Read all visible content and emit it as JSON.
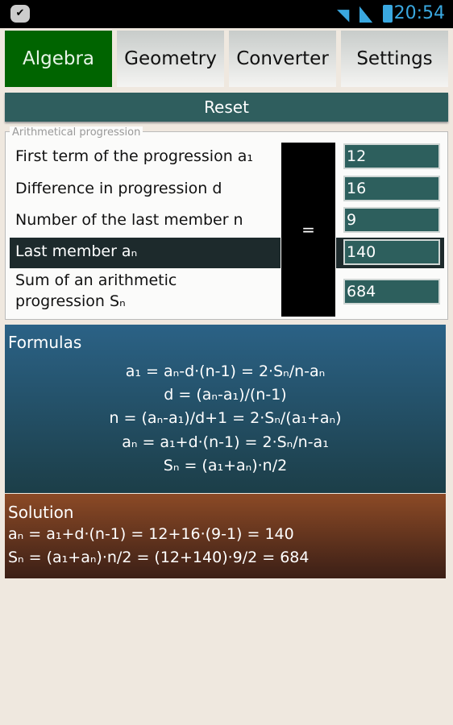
{
  "status_bar": {
    "time": "20:54",
    "icons": [
      "notification-check-icon",
      "wifi-icon",
      "signal-icon",
      "battery-icon"
    ]
  },
  "tabs": [
    {
      "label": "Algebra",
      "active": true
    },
    {
      "label": "Geometry"
    },
    {
      "label": "Converter"
    },
    {
      "label": "Settings"
    }
  ],
  "reset_label": "Reset",
  "progression": {
    "legend": "Arithmetical progression",
    "equals_label": "=",
    "rows": [
      {
        "label": "First term of the progression a₁",
        "value": "12"
      },
      {
        "label": "Difference in progression d",
        "value": "16"
      },
      {
        "label": "Number of the last member n",
        "value": "9"
      },
      {
        "label": "Last member aₙ",
        "value": "140",
        "selected": true
      },
      {
        "label": "Sum of an arithmetic progression Sₙ",
        "value": "684"
      }
    ]
  },
  "formulas": {
    "title": "Formulas",
    "lines": [
      "a₁ = aₙ-d·(n-1) = 2·Sₙ/n-aₙ",
      "d = (aₙ-a₁)/(n-1)",
      "n = (aₙ-a₁)/d+1 = 2·Sₙ/(a₁+aₙ)",
      "aₙ = a₁+d·(n-1) = 2·Sₙ/n-a₁",
      "Sₙ = (a₁+aₙ)·n/2"
    ]
  },
  "solution": {
    "title": "Solution",
    "lines": [
      "aₙ = a₁+d·(n-1) = 12+16·(9-1) = 140",
      "Sₙ = (a₁+aₙ)·n/2 = (12+140)·9/2 = 684"
    ]
  },
  "colors": {
    "active_tab": "#006400",
    "reset": "#2f5e5e",
    "input": "#2d5f5d",
    "formulas": "#2b6286",
    "solution": "#8c4a26"
  }
}
